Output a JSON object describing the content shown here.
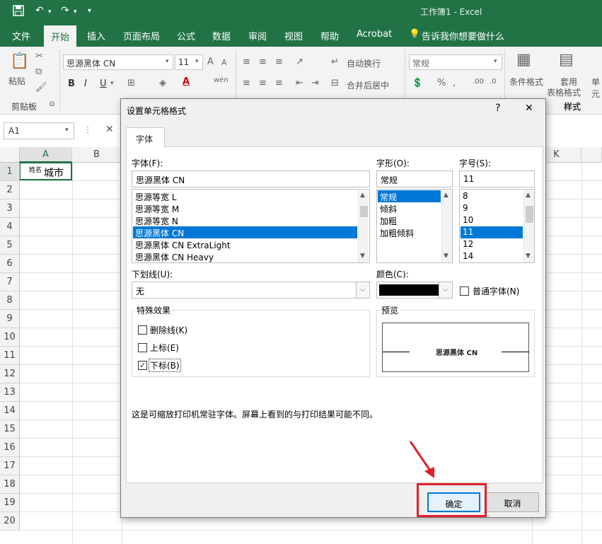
{
  "app": {
    "window_title": "工作簿1 - Excel"
  },
  "tabs": [
    "文件",
    "开始",
    "插入",
    "页面布局",
    "公式",
    "数据",
    "审阅",
    "视图",
    "帮助",
    "Acrobat",
    "告诉我你想要做什么"
  ],
  "ribbon": {
    "paste_label": "粘贴",
    "clipboard_group": "剪贴板",
    "font_name": "思源黑体 CN",
    "font_size": "11",
    "bold": "B",
    "italic": "I",
    "underline": "U",
    "wrap_text": "自动换行",
    "merge_center": "合并后居中",
    "number_format": "常规",
    "conditional_format": "条件格式",
    "table_format_line1": "套用",
    "table_format_line2": "表格格式",
    "styles_group": "样式",
    "cell_styles": "单元"
  },
  "formula_bar": {
    "name_box": "A1",
    "cancel_icon": "✕"
  },
  "grid": {
    "columns": [
      "A",
      "B",
      "",
      "",
      "",
      "",
      "",
      "",
      "",
      "",
      "K"
    ],
    "rows": [
      "1",
      "2",
      "3",
      "4",
      "5",
      "6",
      "7",
      "8",
      "9",
      "10",
      "11",
      "12",
      "13",
      "14",
      "15",
      "16",
      "17",
      "18",
      "19",
      "20"
    ],
    "cell_a1_small": "姓名",
    "cell_a1_text": "城市"
  },
  "dialog": {
    "title": "设置单元格格式",
    "help": "?",
    "close": "✕",
    "tab": "字体",
    "font_label": "字体(F):",
    "font_value": "思源黑体 CN",
    "font_list": [
      "思源等宽 L",
      "思源等宽 M",
      "思源等宽 N",
      "思源黑体 CN",
      "思源黑体 CN ExtraLight",
      "思源黑体 CN Heavy"
    ],
    "font_selected": 3,
    "style_label": "字形(O):",
    "style_value": "常规",
    "style_list": [
      "常规",
      "倾斜",
      "加粗",
      "加粗倾斜"
    ],
    "style_selected": 0,
    "size_label": "字号(S):",
    "size_value": "11",
    "size_list": [
      "8",
      "9",
      "10",
      "11",
      "12",
      "14"
    ],
    "size_selected": 3,
    "underline_label": "下划线(U):",
    "underline_value": "无",
    "color_label": "颜色(C):",
    "color_value": "#000000",
    "normal_font_label": "普通字体(N)",
    "effects_label": "特殊效果",
    "strikethrough_label": "删除线(K)",
    "superscript_label": "上标(E)",
    "subscript_label": "下标(B)",
    "subscript_checked": "✓",
    "preview_label": "预览",
    "preview_text": "思源黑体 CN",
    "note": "这是可缩放打印机常驻字体。屏幕上看到的与打印结果可能不同。",
    "ok": "确定",
    "cancel": "取消"
  },
  "colors": {
    "excel_green": "#217346",
    "highlight_red": "#e0202a",
    "selection_blue": "#0078d7"
  }
}
